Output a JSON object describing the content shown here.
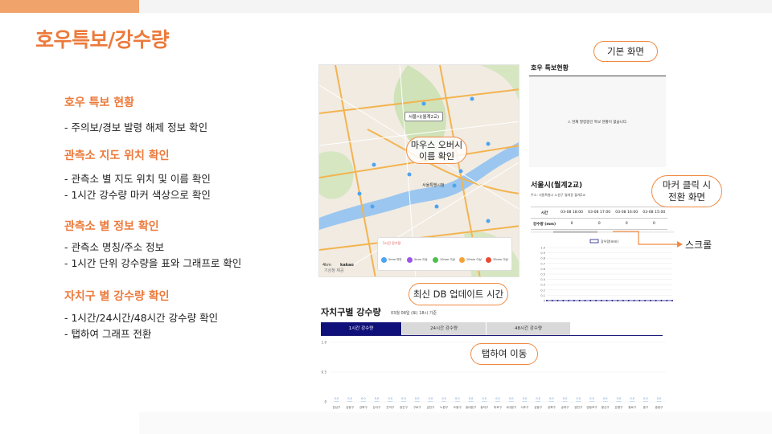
{
  "slide": {
    "title": "호우특보/강수량",
    "sections": [
      {
        "heading": "호우 특보 현황",
        "lines": [
          "- 주의보/경보 발령 해제 정보 확인"
        ]
      },
      {
        "heading": "관측소 지도 위치 확인",
        "lines": [
          "- 관측소 별 지도 위치 및 이름 확인",
          "- 1시간 강수량 마커 색상으로  확인"
        ]
      },
      {
        "heading": "관측소 별 정보 확인",
        "lines": [
          "- 관측소 명칭/주소 정보",
          "- 1시간 단위 강수량을 표와 그래프로 확인"
        ]
      },
      {
        "heading": "자치구 별 강수량 확인",
        "lines": [
          "- 1시간/24시간/48시간 강수량 확인",
          "- 탭하여 그래프 전환"
        ]
      }
    ]
  },
  "map": {
    "station_popup": "서울시(월계2교)",
    "city_hall": "서울특별시청",
    "copyright": "기상청 제공",
    "scale": "4km",
    "brand": "kakao",
    "legend_title": "1시간 강수량",
    "legend": [
      {
        "label": "5mm 미만",
        "color": "#4fa3ee"
      },
      {
        "label": "5mm 이상",
        "color": "#9a55e8"
      },
      {
        "label": "10mm 이상",
        "color": "#4cc04c"
      },
      {
        "label": "20mm 이상",
        "color": "#f3a23a"
      },
      {
        "label": "30mm 이상",
        "color": "#e84a32"
      }
    ]
  },
  "callouts": {
    "base_screen": "기본 화면",
    "mouse_over_1": "마우스 오버시",
    "mouse_over_2": "이름 확인",
    "marker_click_1": "마커 클릭 시",
    "marker_click_2": "전환 화면",
    "scroll": "스크롤",
    "db_update": "최신 DB 업데이트 시간",
    "tab_move": "탭하여 이동"
  },
  "warning_panel": {
    "title": "호우 특보현황",
    "message": "⚠ 현재 발령중인 특보 현황이 없습니다."
  },
  "station_panel": {
    "name": "서울시(월계2교)",
    "address": "주소: 서울특별시 노원구 월계동 월계2교",
    "times": [
      "시간",
      "03-08 18:00",
      "03-08 17:00",
      "03-08 16:00",
      "03-08 15:00"
    ],
    "values": [
      "강수량 (mm)",
      "0",
      "0",
      "0",
      "0"
    ]
  },
  "district_panel": {
    "title": "자치구별 강수량",
    "updated": "03월 08일 (토) 18시 기준",
    "tabs": [
      "1시간 강수량",
      "24시간 강수량",
      "48시간 강수량"
    ],
    "active_tab": 0
  },
  "chart_data": [
    {
      "type": "line",
      "title": "",
      "series": [
        {
          "name": "강우량(mm)",
          "values": [
            0,
            0,
            0,
            0,
            0,
            0,
            0,
            0,
            0,
            0,
            0,
            0,
            0,
            0,
            0,
            0,
            0,
            0,
            0,
            0,
            0,
            0,
            0,
            0
          ]
        }
      ],
      "ylim": [
        0,
        1.0
      ],
      "yticks": [
        "1.0",
        "0.9",
        "0.8",
        "0.7",
        "0.6",
        "0.5",
        "0.4",
        "0.3",
        "0.2",
        "0.1",
        "0"
      ],
      "color": "#1a1a8a"
    },
    {
      "type": "bar",
      "title": "",
      "categories": [
        "강남구",
        "강동구",
        "강북구",
        "강서구",
        "관악구",
        "광진구",
        "구로구",
        "금천구",
        "노원구",
        "도봉구",
        "동대문구",
        "동작구",
        "마포구",
        "서대문구",
        "서초구",
        "성동구",
        "성북구",
        "송파구",
        "양천구",
        "영등포구",
        "용산구",
        "은평구",
        "종로구",
        "중구",
        "중랑구"
      ],
      "values": [
        0,
        0,
        0,
        0,
        0,
        0,
        0,
        0,
        0,
        0,
        0,
        0,
        0,
        0,
        0,
        0,
        0,
        0,
        0,
        0,
        0,
        0,
        0,
        0,
        0
      ],
      "data_label": "0.0",
      "ylim": [
        0,
        1.0
      ],
      "yticks": [
        "1.0",
        "0.5",
        "0"
      ],
      "color": "#8ab8e8"
    }
  ]
}
